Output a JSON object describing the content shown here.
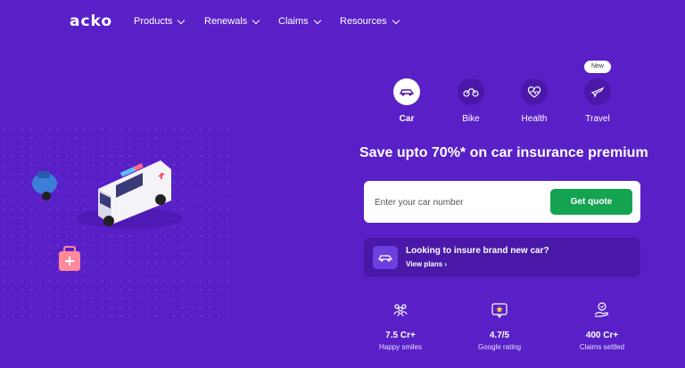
{
  "brand": {
    "logo_text": "acko"
  },
  "nav": {
    "items": [
      {
        "label": "Products"
      },
      {
        "label": "Renewals"
      },
      {
        "label": "Claims"
      },
      {
        "label": "Resources"
      }
    ]
  },
  "categories": {
    "items": [
      {
        "label": "Car",
        "icon": "car-icon",
        "active": true
      },
      {
        "label": "Bike",
        "icon": "bike-icon",
        "active": false
      },
      {
        "label": "Health",
        "icon": "health-icon",
        "active": false
      },
      {
        "label": "Travel",
        "icon": "plane-icon",
        "active": false
      }
    ],
    "new_badge": "New"
  },
  "hero": {
    "headline": "Save upto 70%* on car insurance premium",
    "search_placeholder": "Enter your car number",
    "quote_button": "Get quote"
  },
  "new_car": {
    "title": "Looking to insure brand new car?",
    "link": "View plans ›"
  },
  "stats": [
    {
      "value": "7.5 Cr+",
      "label": "Happy smiles",
      "icon": "people-icon"
    },
    {
      "value": "4.7/5",
      "label": "Google rating",
      "icon": "rating-icon"
    },
    {
      "value": "400 Cr+",
      "label": "Claims settled",
      "icon": "hand-money-icon"
    }
  ],
  "colors": {
    "background": "#5920c8",
    "accent_green": "#14a350",
    "dark_purple": "#4a18a8"
  }
}
